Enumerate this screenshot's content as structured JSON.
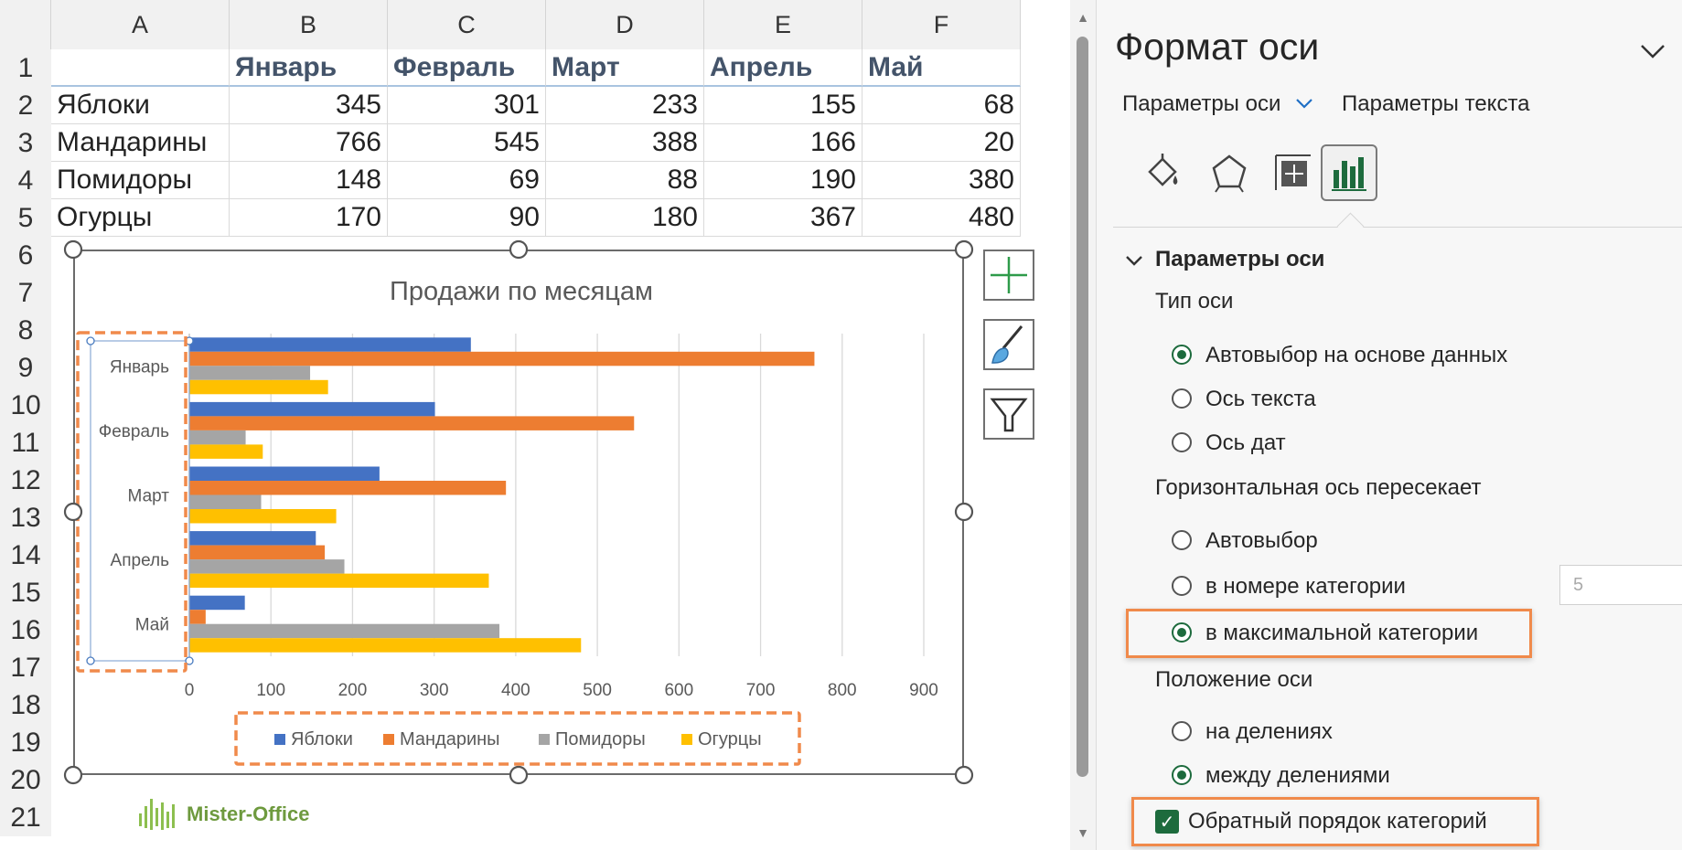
{
  "sheet": {
    "columns": [
      "A",
      "B",
      "C",
      "D",
      "E",
      "F"
    ],
    "rows": [
      "1",
      "2",
      "3",
      "4",
      "5",
      "6",
      "7",
      "8",
      "9",
      "10",
      "11",
      "12",
      "13",
      "14",
      "15",
      "16",
      "17",
      "18",
      "19",
      "20",
      "21"
    ],
    "header": [
      "",
      "Январь",
      "Февраль",
      "Март",
      "Апрель",
      "Май"
    ],
    "data": [
      {
        "label": "Яблоки",
        "values": [
          "345",
          "301",
          "233",
          "155",
          "68"
        ]
      },
      {
        "label": "Мандарины",
        "values": [
          "766",
          "545",
          "388",
          "166",
          "20"
        ]
      },
      {
        "label": "Помидоры",
        "values": [
          "148",
          "69",
          "88",
          "190",
          "380"
        ]
      },
      {
        "label": "Огурцы",
        "values": [
          "170",
          "90",
          "180",
          "367",
          "480"
        ]
      }
    ]
  },
  "chart_data": {
    "type": "bar",
    "orientation": "horizontal",
    "title": "Продажи по месяцам",
    "categories": [
      "Январь",
      "Февраль",
      "Март",
      "Апрель",
      "Май"
    ],
    "series": [
      {
        "name": "Яблоки",
        "values": [
          345,
          301,
          233,
          155,
          68
        ],
        "color": "#4472C4"
      },
      {
        "name": "Мандарины",
        "values": [
          766,
          545,
          388,
          166,
          20
        ],
        "color": "#ED7D31"
      },
      {
        "name": "Помидоры",
        "values": [
          148,
          69,
          88,
          190,
          380
        ],
        "color": "#A5A5A5"
      },
      {
        "name": "Огурцы",
        "values": [
          170,
          90,
          180,
          367,
          480
        ],
        "color": "#FFC000"
      }
    ],
    "xlim": [
      0,
      900
    ],
    "xticks": [
      "0",
      "100",
      "200",
      "300",
      "400",
      "500",
      "600",
      "700",
      "800",
      "900"
    ],
    "grid": true,
    "legend_position": "bottom",
    "categories_reversed": true
  },
  "watermark": "Mister-Office",
  "panel": {
    "title": "Формат оси",
    "tab_axis": "Параметры оси",
    "tab_text": "Параметры текста",
    "icons": [
      "fill-line-icon",
      "effects-icon",
      "size-properties-icon",
      "axis-options-icon"
    ],
    "section_title": "Параметры оси",
    "axis_type_label": "Тип оси",
    "axis_type_options": [
      {
        "label": "Автовыбор на основе данных",
        "selected": true
      },
      {
        "label": "Ось текста",
        "selected": false
      },
      {
        "label": "Ось дат",
        "selected": false
      }
    ],
    "crosses_label": "Горизонтальная ось пересекает",
    "crosses_options": [
      {
        "label": "Автовыбор",
        "selected": false
      },
      {
        "label": "в номере категории",
        "selected": false
      },
      {
        "label": "в максимальной категории",
        "selected": true
      }
    ],
    "crosses_number": "5",
    "position_label": "Положение оси",
    "position_options": [
      {
        "label": "на делениях",
        "selected": false
      },
      {
        "label": "между делениями",
        "selected": true
      }
    ],
    "reverse_label": "Обратный порядок категорий",
    "reverse_checked": true
  },
  "colors": {
    "accent_green": "#1d6b3d",
    "highlight_orange": "#f08a4b",
    "header_blue": "#44546a"
  }
}
